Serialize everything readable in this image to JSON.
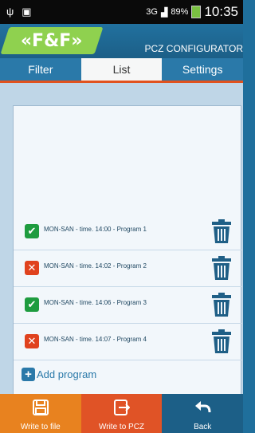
{
  "statusbar": {
    "usb": "ψ",
    "image_icon": "image-icon",
    "network": "3G",
    "battery": "89%",
    "time": "10:35"
  },
  "header": {
    "logo": "«F&F»",
    "title": "PCZ CONFIGURATOR"
  },
  "tabs": [
    {
      "label": "Filter",
      "active": false
    },
    {
      "label": "List",
      "active": true
    },
    {
      "label": "Settings",
      "active": false
    }
  ],
  "programs": [
    {
      "text": "MON-SAN - time. 14:00 - Program 1",
      "enabled": true
    },
    {
      "text": "MON-SAN - time. 14:02 - Program 2",
      "enabled": false
    },
    {
      "text": "MON-SAN - time. 14:06 - Program 3",
      "enabled": true
    },
    {
      "text": "MON-SAN - time. 14:07 - Program 4",
      "enabled": false
    }
  ],
  "add_program": {
    "label": "Add program"
  },
  "bottom": [
    {
      "label": "Write to file",
      "icon": "save-icon"
    },
    {
      "label": "Write to PCZ",
      "icon": "export-icon"
    },
    {
      "label": "Back",
      "icon": "back-arrow-icon"
    }
  ],
  "colors": {
    "accent": "#e0521e",
    "primary": "#1f6f9c",
    "enabled": "#1e9c3f",
    "disabled": "#e0421e"
  }
}
